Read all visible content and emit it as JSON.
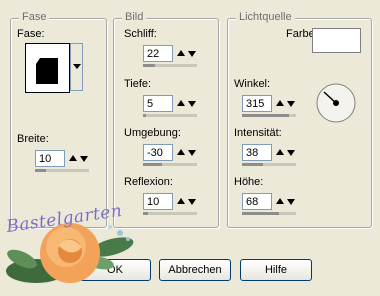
{
  "fase_group": {
    "title": "Fase",
    "fase_label": "Fase:",
    "breite_label": "Breite:",
    "breite_value": "10",
    "breite_level": 0.2
  },
  "bild_group": {
    "title": "Bild",
    "schliff_label": "Schliff:",
    "schliff_value": "22",
    "schliff_level": 0.22,
    "tiefe_label": "Tiefe:",
    "tiefe_value": "5",
    "tiefe_level": 0.05,
    "umgebung_label": "Umgebung:",
    "umgebung_value": "-30",
    "umgebung_level": 0.35,
    "reflexion_label": "Reflexion:",
    "reflexion_value": "10",
    "reflexion_level": 0.1
  },
  "licht_group": {
    "title": "Lichtquelle",
    "farbe_label": "Farbe:",
    "farbe_color": "#ffffff",
    "winkel_label": "Winkel:",
    "winkel_value": "315",
    "winkel_level": 0.875,
    "intensitaet_label": "Intensität:",
    "intensitaet_value": "38",
    "intensitaet_level": 0.38,
    "hoehe_label": "Höhe:",
    "hoehe_value": "68",
    "hoehe_level": 0.68
  },
  "buttons": {
    "ok_label": "OK",
    "abbrechen_label": "Abbrechen",
    "hilfe_label": "Hilfe"
  },
  "watermark": {
    "text": "Bastelgarten"
  }
}
